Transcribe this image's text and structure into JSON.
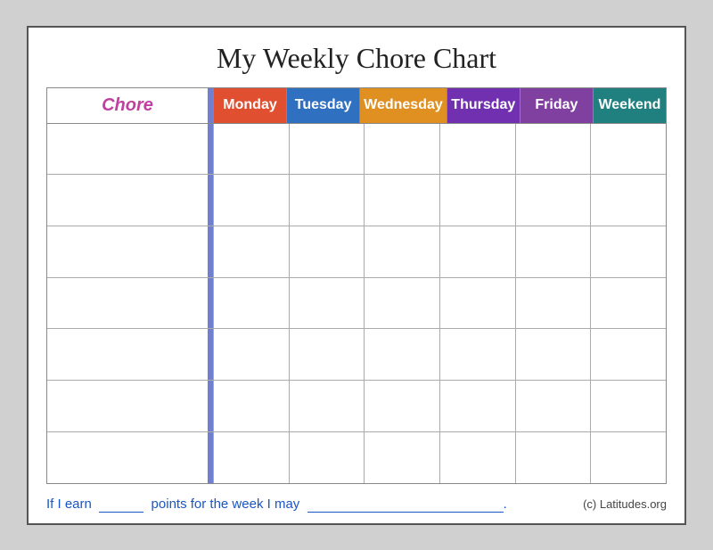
{
  "title": "My Weekly Chore Chart",
  "header": {
    "chore_label": "Chore",
    "days": [
      {
        "label": "Monday",
        "class": "monday"
      },
      {
        "label": "Tuesday",
        "class": "tuesday"
      },
      {
        "label": "Wednesday",
        "class": "wednesday"
      },
      {
        "label": "Thursday",
        "class": "thursday"
      },
      {
        "label": "Friday",
        "class": "friday"
      },
      {
        "label": "Weekend",
        "class": "weekend"
      }
    ]
  },
  "rows": [
    {},
    {},
    {},
    {},
    {},
    {},
    {}
  ],
  "footer": {
    "prefix": "If I earn",
    "blank1": "",
    "middle": "points for the week I may",
    "blank2": "",
    "suffix": "."
  },
  "copyright": "(c) Latitudes.org"
}
